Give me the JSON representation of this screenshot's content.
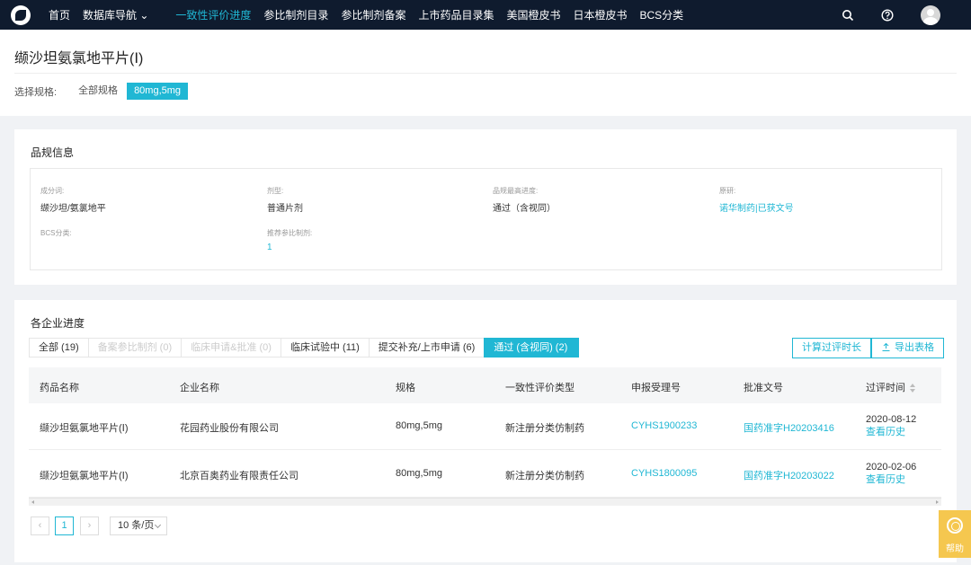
{
  "nav": {
    "items": [
      {
        "label": "首页"
      },
      {
        "label": "数据库导航 ⌄"
      },
      {
        "label": "一致性评价进度"
      },
      {
        "label": "参比制剂目录"
      },
      {
        "label": "参比制剂备案"
      },
      {
        "label": "上市药品目录集"
      },
      {
        "label": "美国橙皮书"
      },
      {
        "label": "日本橙皮书"
      },
      {
        "label": "BCS分类"
      }
    ],
    "active_color": "#20b7d4",
    "bg_color": "#0f1b2e"
  },
  "page": {
    "title": "缬沙坦氨氯地平片(Ⅰ)",
    "spec_label": "选择规格:",
    "spec_options": [
      "全部规格",
      "80mg,5mg"
    ]
  },
  "info": {
    "title": "品规信息",
    "fields": [
      {
        "label": "成分词:",
        "value": "缬沙坦/氨氯地平"
      },
      {
        "label": "剂型:",
        "value": "普通片剂"
      },
      {
        "label": "品规最高进度:",
        "value": "通过（含视同）"
      },
      {
        "label": "原研:",
        "value": "诺华制药|已获文号"
      },
      {
        "label": "BCS分类:",
        "value": ""
      },
      {
        "label": "推荐参比制剂:",
        "value": "1"
      }
    ]
  },
  "progress": {
    "title": "各企业进度",
    "tabs": [
      {
        "label": "全部 (19)"
      },
      {
        "label": "备案参比制剂 (0)"
      },
      {
        "label": "临床申请&批准 (0)"
      },
      {
        "label": "临床试验中 (11)"
      },
      {
        "label": "提交补充/上市申请 (6)"
      },
      {
        "label": "通过 (含视同) (2)"
      }
    ],
    "calc_button": "计算过评时长",
    "export_button": "导出表格",
    "columns": [
      "药品名称",
      "企业名称",
      "规格",
      "一致性评价类型",
      "申报受理号",
      "批准文号",
      "过评时间"
    ],
    "rows": [
      {
        "name": "缬沙坦氨氯地平片(Ⅰ)",
        "company": "花园药业股份有限公司",
        "spec": "80mg,5mg",
        "type": "新注册分类仿制药",
        "accept_no": "CYHS1900233",
        "approval_no": "国药准字H20203416",
        "date": "2020-08-12",
        "history": "查看历史"
      },
      {
        "name": "缬沙坦氨氯地平片(Ⅰ)",
        "company": "北京百奥药业有限责任公司",
        "spec": "80mg,5mg",
        "type": "新注册分类仿制药",
        "accept_no": "CYHS1800095",
        "approval_no": "国药准字H20203022",
        "date": "2020-02-06",
        "history": "查看历史"
      }
    ],
    "pagination": {
      "current": "1",
      "page_size": "10 条/页"
    }
  },
  "help": {
    "label": "帮助"
  }
}
